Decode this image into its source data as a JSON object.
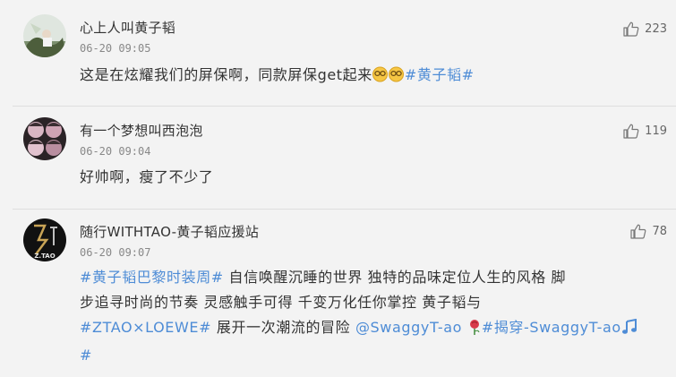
{
  "comments": [
    {
      "username": "心上人叫黄子韬",
      "time": "06-20 09:05",
      "likes": "223",
      "text_plain": "这是在炫耀我们的屏保啊，同款屏保get起来",
      "emoji": "😘😘",
      "hashtag": "#黄子韬#"
    },
    {
      "username": "有一个梦想叫西泡泡",
      "time": "06-20 09:04",
      "likes": "119",
      "text_plain": "好帅啊，瘦了不少了"
    },
    {
      "username": "随行WITHTAO-黄子韬应援站",
      "avatar_text": "Z.TAO",
      "time": "06-20 09:07",
      "likes": "78",
      "hashtag1": "#黄子韬巴黎时装周#",
      "line1_rest": " 自信唤醒沉睡的世界 独特的品味定位人生的风格 脚",
      "line2": "步追寻时尚的节奏  灵感触手可得  千变万化任你掌控  黄子韬与",
      "hashtag2": "#ZTAO×LOEWE#",
      "line3_mid": " 展开一次潮流的冒险 ",
      "mention": "@SwaggyT-ao",
      "rose": "🌹",
      "hashtag3": "#揭穿-SwaggyT-ao",
      "note": "🎵",
      "hashtag3_end": "#"
    }
  ],
  "icons": {
    "like": "thumbs-up-icon"
  },
  "colors": {
    "link": "#4e8cd6",
    "background": "#f3f3f3"
  }
}
